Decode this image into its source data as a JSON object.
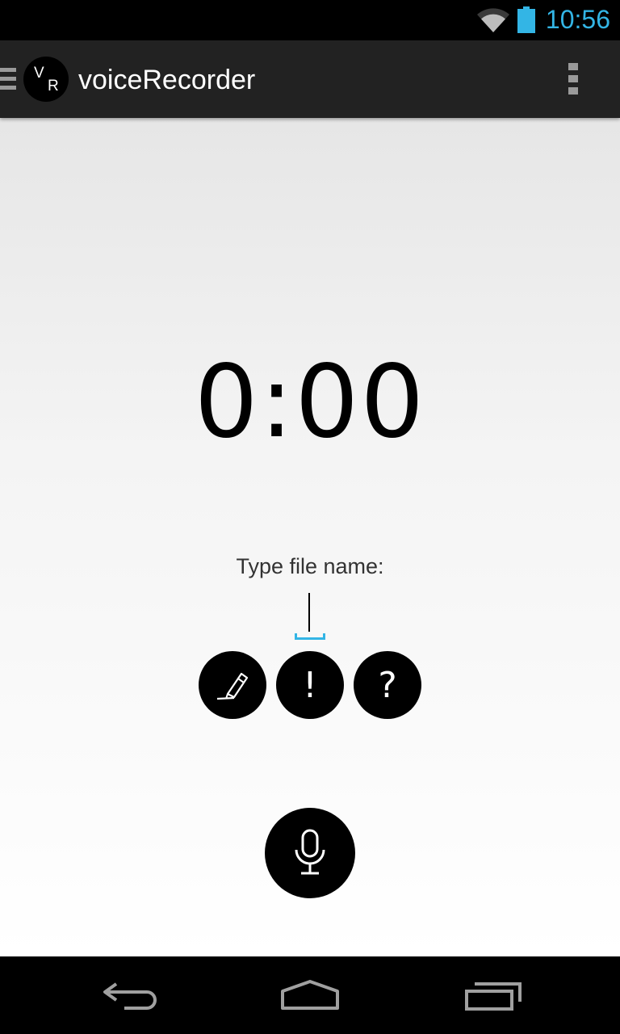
{
  "status_bar": {
    "time": "10:56",
    "accent_color": "#33b5e5",
    "icons": [
      "wifi-icon",
      "battery-icon"
    ]
  },
  "action_bar": {
    "logo_letter_top": "V",
    "logo_letter_bottom": "R",
    "title": "voiceRecorder",
    "icons": [
      "drawer-menu-icon",
      "overflow-menu-icon"
    ]
  },
  "recorder": {
    "timer": "0:00",
    "filename_label": "Type file name:",
    "filename_value": "",
    "buttons": {
      "edit_icon": "pencil-icon",
      "important_label": "!",
      "help_label": "?",
      "record_icon": "microphone-icon"
    }
  },
  "nav_bar": {
    "icons": [
      "back-icon",
      "home-icon",
      "recents-icon"
    ]
  }
}
